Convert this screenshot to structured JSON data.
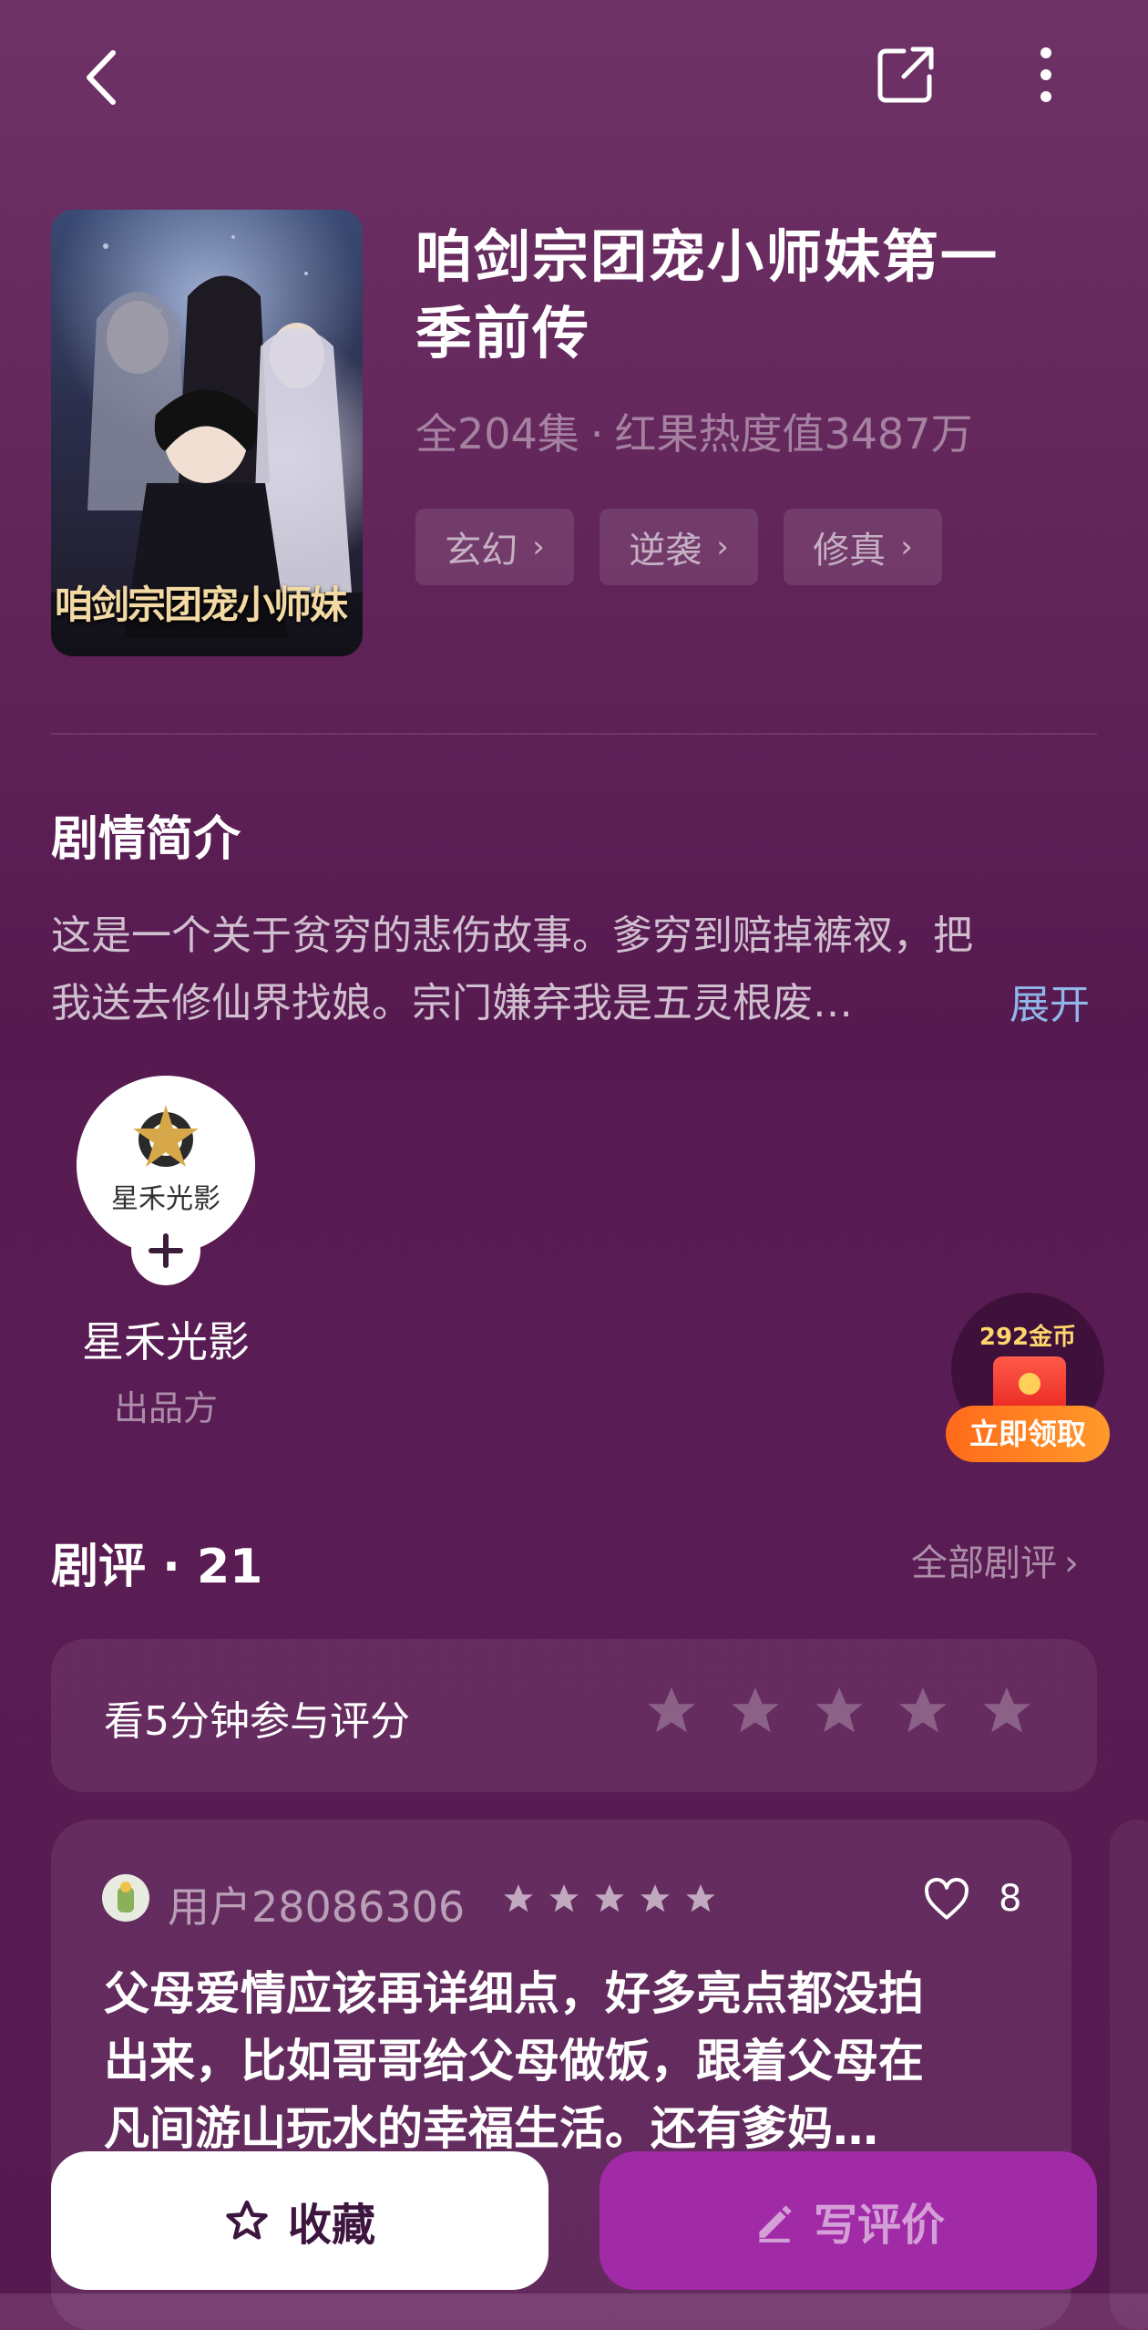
{
  "drama": {
    "title_line1": "咱剑宗团宠小师妹第一",
    "title_line2": "季前传",
    "episodes": "全204集",
    "separator": "·",
    "heat": "红果热度值3487万",
    "cover_text": "咱剑宗团宠小师妹",
    "tags": [
      {
        "label": "玄幻"
      },
      {
        "label": "逆袭"
      },
      {
        "label": "修真"
      }
    ]
  },
  "synopsis": {
    "heading": "剧情简介",
    "line1": "这是一个关于贫穷的悲伤故事。爹穷到赔掉裤衩，把",
    "line2": "我送去修仙界找娘。宗门嫌弃我是五灵根废…",
    "expand": "展开"
  },
  "producer": {
    "logo_text": "星禾光影",
    "name": "星禾光影",
    "role": "出品方"
  },
  "reward": {
    "coins": "292金币",
    "claim": "立即领取"
  },
  "reviews": {
    "heading": "剧评 · 21",
    "all_link": "全部剧评",
    "rate_prompt": "看5分钟参与评分",
    "items": [
      {
        "user": "用户28086306",
        "likes": "8",
        "line1": "父母爱情应该再详细点，好多亮点都没拍",
        "line2": "出来，比如哥哥给父母做饭，跟着父母在",
        "line3": "凡间游山玩水的幸福生活。还有爹妈…"
      }
    ]
  },
  "actions": {
    "favorite": "收藏",
    "write_review": "写评价"
  },
  "colors": {
    "accent_purple": "#a12aa7",
    "link_blue": "#8fb7e8",
    "reward_orange": "#ff7a1a"
  }
}
